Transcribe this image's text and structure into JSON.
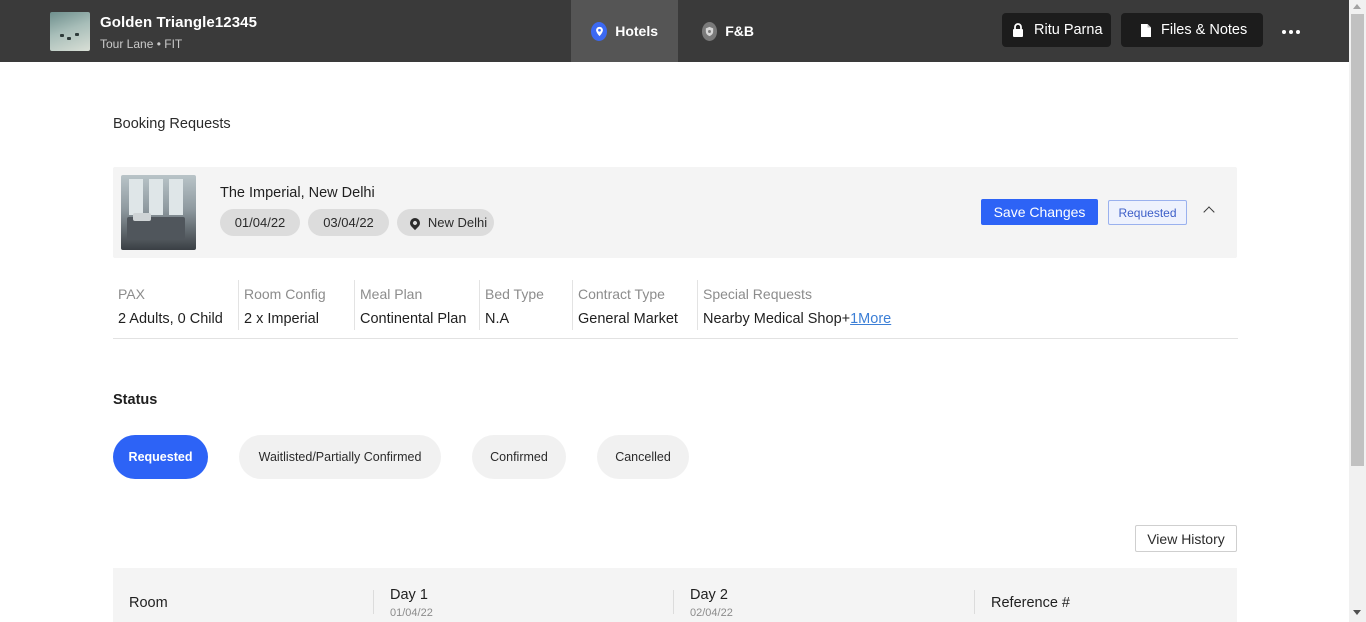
{
  "header": {
    "trip_title": "Golden Triangle12345",
    "trip_subtitle": "Tour Lane • FIT",
    "tabs": [
      {
        "label": "Hotels",
        "icon": "map-pin-icon",
        "active": true
      },
      {
        "label": "F&B",
        "icon": "shield-icon",
        "active": false
      }
    ],
    "user_name": "Ritu Parna",
    "files_label": "Files & Notes",
    "more_icon": "more-horizontal-icon"
  },
  "booking": {
    "section_title": "Booking Requests",
    "hotel_name": "The Imperial, New Delhi",
    "check_in": "01/04/22",
    "check_out": "03/04/22",
    "location": "New Delhi",
    "save_label": "Save Changes",
    "status_tag": "Requested",
    "details": {
      "columns": [
        {
          "label": "PAX",
          "value": "2 Adults, 0 Child"
        },
        {
          "label": "Room Config",
          "value": "2 x Imperial"
        },
        {
          "label": "Meal Plan",
          "value": "Continental Plan"
        },
        {
          "label": "Bed Type",
          "value": "N.A"
        },
        {
          "label": "Contract Type",
          "value": "General Market"
        },
        {
          "label": "Special Requests",
          "value": "Nearby Medical Shop+",
          "more_link": "1More"
        }
      ]
    }
  },
  "status": {
    "title": "Status",
    "options": [
      "Requested",
      "Waitlisted/Partially Confirmed",
      "Confirmed",
      "Cancelled"
    ],
    "selected": "Requested"
  },
  "history": {
    "button_label": "View History"
  },
  "room_grid": {
    "headers": [
      {
        "title": "Room",
        "sub": ""
      },
      {
        "title": "Day 1",
        "sub": "01/04/22"
      },
      {
        "title": "Day 2",
        "sub": "02/04/22"
      },
      {
        "title": "Reference #",
        "sub": ""
      }
    ]
  },
  "colors": {
    "accent": "#2d63f6",
    "topbar": "#3a3a3a"
  }
}
